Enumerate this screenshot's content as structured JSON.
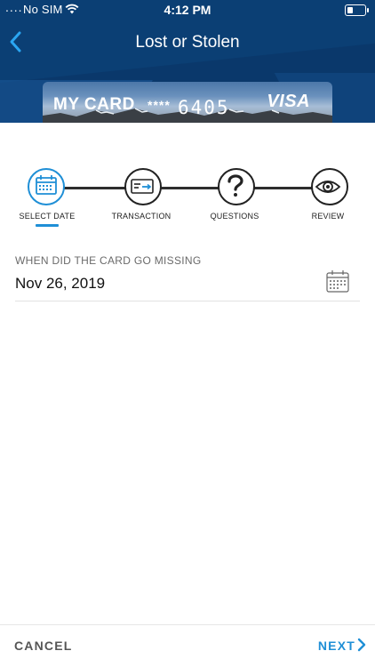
{
  "status_bar": {
    "signal_dots": "....",
    "carrier": "No SIM",
    "time": "4:12 PM"
  },
  "nav": {
    "title": "Lost or Stolen",
    "back_icon": "chevron-left-icon"
  },
  "card": {
    "name": "MY CARD",
    "mask": "****",
    "last4": "6405",
    "brand": "VISA"
  },
  "stepper": {
    "steps": [
      {
        "label": "SELECT DATE",
        "icon": "calendar-icon",
        "active": true
      },
      {
        "label": "TRANSACTION",
        "icon": "card-transaction-icon",
        "active": false
      },
      {
        "label": "QUESTIONS",
        "icon": "question-icon",
        "active": false
      },
      {
        "label": "REVIEW",
        "icon": "eye-icon",
        "active": false
      }
    ]
  },
  "form": {
    "date_label": "WHEN DID THE CARD GO MISSING",
    "date_value": "Nov 26, 2019",
    "calendar_icon": "calendar-icon"
  },
  "footer": {
    "cancel_label": "CANCEL",
    "next_label": "NEXT"
  },
  "colors": {
    "header_bg": "#0b3f74",
    "accent": "#1f8fd6",
    "step_line": "#2d2d2d"
  }
}
